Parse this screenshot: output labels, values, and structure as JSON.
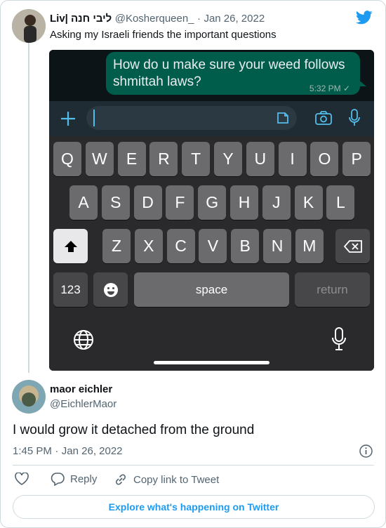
{
  "tweet": {
    "display_name": "Liv| ליבי חנה",
    "handle": "@Kosherqueen_",
    "date": "Jan 26, 2022",
    "separator": "·",
    "text": "Asking my Israeli friends the important questions"
  },
  "embedded_screenshot": {
    "message": "How do u make sure your weed follows shmittah laws?",
    "message_time": "5:32 PM ✓",
    "keyboard": {
      "row1": [
        "Q",
        "W",
        "E",
        "R",
        "T",
        "Y",
        "U",
        "I",
        "O",
        "P"
      ],
      "row2": [
        "A",
        "S",
        "D",
        "F",
        "G",
        "H",
        "J",
        "K",
        "L"
      ],
      "row3": [
        "Z",
        "X",
        "C",
        "V",
        "B",
        "N",
        "M"
      ],
      "numbers_key": "123",
      "space_key": "space",
      "return_key": "return"
    }
  },
  "reply": {
    "display_name": "maor eichler",
    "handle": "@EichlerMaor",
    "text": "I would grow it detached from the ground",
    "time": "1:45 PM",
    "separator": "·",
    "date": "Jan 26, 2022"
  },
  "actions": {
    "reply_label": "Reply",
    "copy_link_label": "Copy link to Tweet"
  },
  "explore_label": "Explore what's happening on Twitter",
  "colors": {
    "twitter_blue": "#1d9bf0",
    "whatsapp_bubble": "#005c4b",
    "muted_text": "#536471"
  },
  "icons": [
    "twitter-bird-icon",
    "plus-icon",
    "sticker-icon",
    "camera-icon",
    "microphone-icon",
    "shift-icon",
    "backspace-icon",
    "emoji-icon",
    "globe-icon",
    "info-icon",
    "heart-icon",
    "reply-icon",
    "link-icon"
  ]
}
